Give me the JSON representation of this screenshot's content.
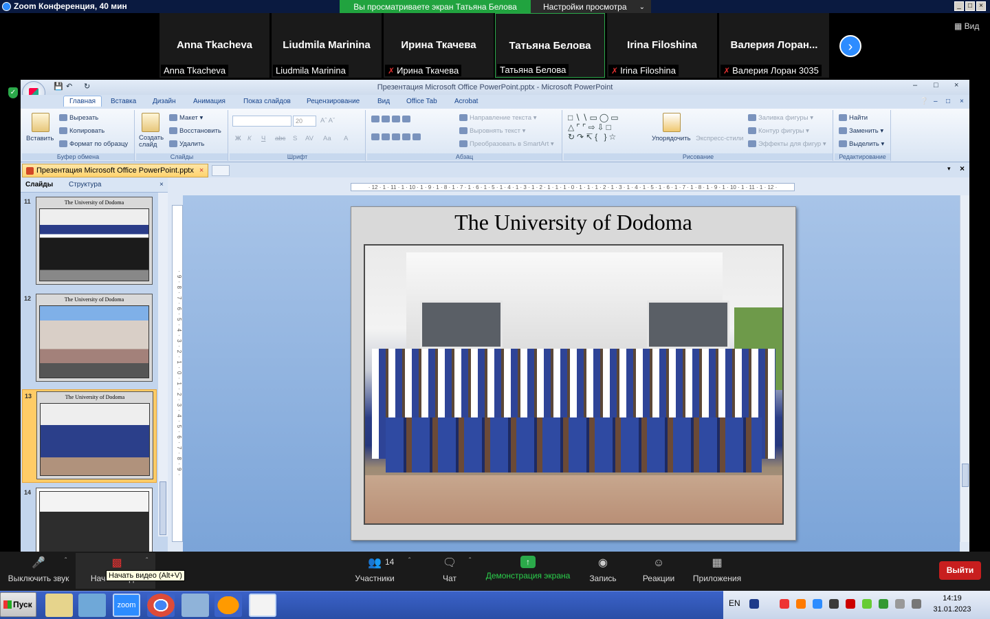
{
  "zoom": {
    "window_title": "Zoom Конференция, 40 мин",
    "share_banner": "Вы просматриваете экран Татьяна Белова",
    "view_options": "Настройки просмотра",
    "view_button": "Вид",
    "participants": [
      {
        "display": "Anna Tkacheva",
        "label": "Anna Tkacheva",
        "muted": false
      },
      {
        "display": "Liudmila Marinina",
        "label": "Liudmila Marinina",
        "muted": false
      },
      {
        "display": "Ирина Ткачева",
        "label": "Ирина Ткачева",
        "muted": true
      },
      {
        "display": "Татьяна Белова",
        "label": "Татьяна Белова",
        "muted": false,
        "active": true
      },
      {
        "display": "Irina Filoshina",
        "label": "Irina Filoshina",
        "muted": true
      },
      {
        "display": "Валерия  Лоран...",
        "label": "Валерия Лоран 3035",
        "muted": true
      }
    ],
    "toolbar": {
      "mute": "Выключить звук",
      "video": "Начать видео",
      "video_tooltip": "Начать видео (Alt+V)",
      "participants": "Участники",
      "participants_count": "14",
      "chat": "Чат",
      "share": "Демонстрация экрана",
      "record": "Запись",
      "reactions": "Реакции",
      "apps": "Приложения",
      "leave": "Выйти"
    },
    "colors": {
      "share_green": "#21a33f",
      "leave_red": "#c81e1e",
      "zoom_blue": "#2d8cff"
    }
  },
  "ppt": {
    "title": "Презентация Microsoft Office PowerPoint.pptx - Microsoft PowerPoint",
    "tabs": [
      "Главная",
      "Вставка",
      "Дизайн",
      "Анимация",
      "Показ слайдов",
      "Рецензирование",
      "Вид",
      "Office Tab",
      "Acrobat"
    ],
    "active_tab": "Главная",
    "ribbon": {
      "clipboard": {
        "name": "Буфер обмена",
        "paste": "Вставить",
        "cut": "Вырезать",
        "copy": "Копировать",
        "format": "Формат по образцу"
      },
      "slides": {
        "name": "Слайды",
        "create": "Создать слайд",
        "layout": "Макет",
        "reset": "Восстановить",
        "delete": "Удалить"
      },
      "font": {
        "name": "Шрифт",
        "size": "20"
      },
      "paragraph": {
        "name": "Абзац",
        "text_dir": "Направление текста",
        "align_text": "Выровнять текст",
        "smartart": "Преобразовать в SmartArt"
      },
      "drawing": {
        "name": "Рисование",
        "arrange": "Упорядочить",
        "quick_styles": "Экспресс-стили",
        "fill": "Заливка фигуры",
        "outline": "Контур фигуры",
        "effects": "Эффекты для фигур"
      },
      "editing": {
        "name": "Редактирование",
        "find": "Найти",
        "replace": "Заменить",
        "select": "Выделить"
      }
    },
    "doc_tab": "Презентация Microsoft Office PowerPoint.pptx",
    "panel_tabs": {
      "slides": "Слайды",
      "outline": "Структура"
    },
    "thumbnails": [
      {
        "num": "11",
        "title": "The University of Dodoma"
      },
      {
        "num": "12",
        "title": "The University of Dodoma"
      },
      {
        "num": "13",
        "title": "The University of Dodoma",
        "selected": true
      },
      {
        "num": "14",
        "title": ""
      }
    ],
    "slide_title": "The University of Dodoma",
    "hruler": "· 12 · 1 · 11 · 1 · 10 · 1 · 9 · 1 · 8 · 1 · 7 · 1 · 6 · 1 · 5 · 1 · 4 · 1 · 3 · 1 · 2 · 1 · 1 · 1 · 0 · 1 · 1 · 1 · 2 · 1 · 3 · 1 · 4 · 1 · 5 · 1 · 6 · 1 · 7 · 1 · 8 · 1 · 9 · 1 · 10 · 1 · 11 · 1 · 12 ·",
    "vruler": "· 9 · 8 · 7 · 6 · 5 · 4 · 3 · 2 · 1 · 0 · 1 · 2 · 3 · 4 · 5 · 6 · 7 · 8 · 9 ·"
  },
  "taskbar": {
    "start": "Пуск",
    "lang": "EN",
    "time": "14:19",
    "date": "31.01.2023"
  }
}
